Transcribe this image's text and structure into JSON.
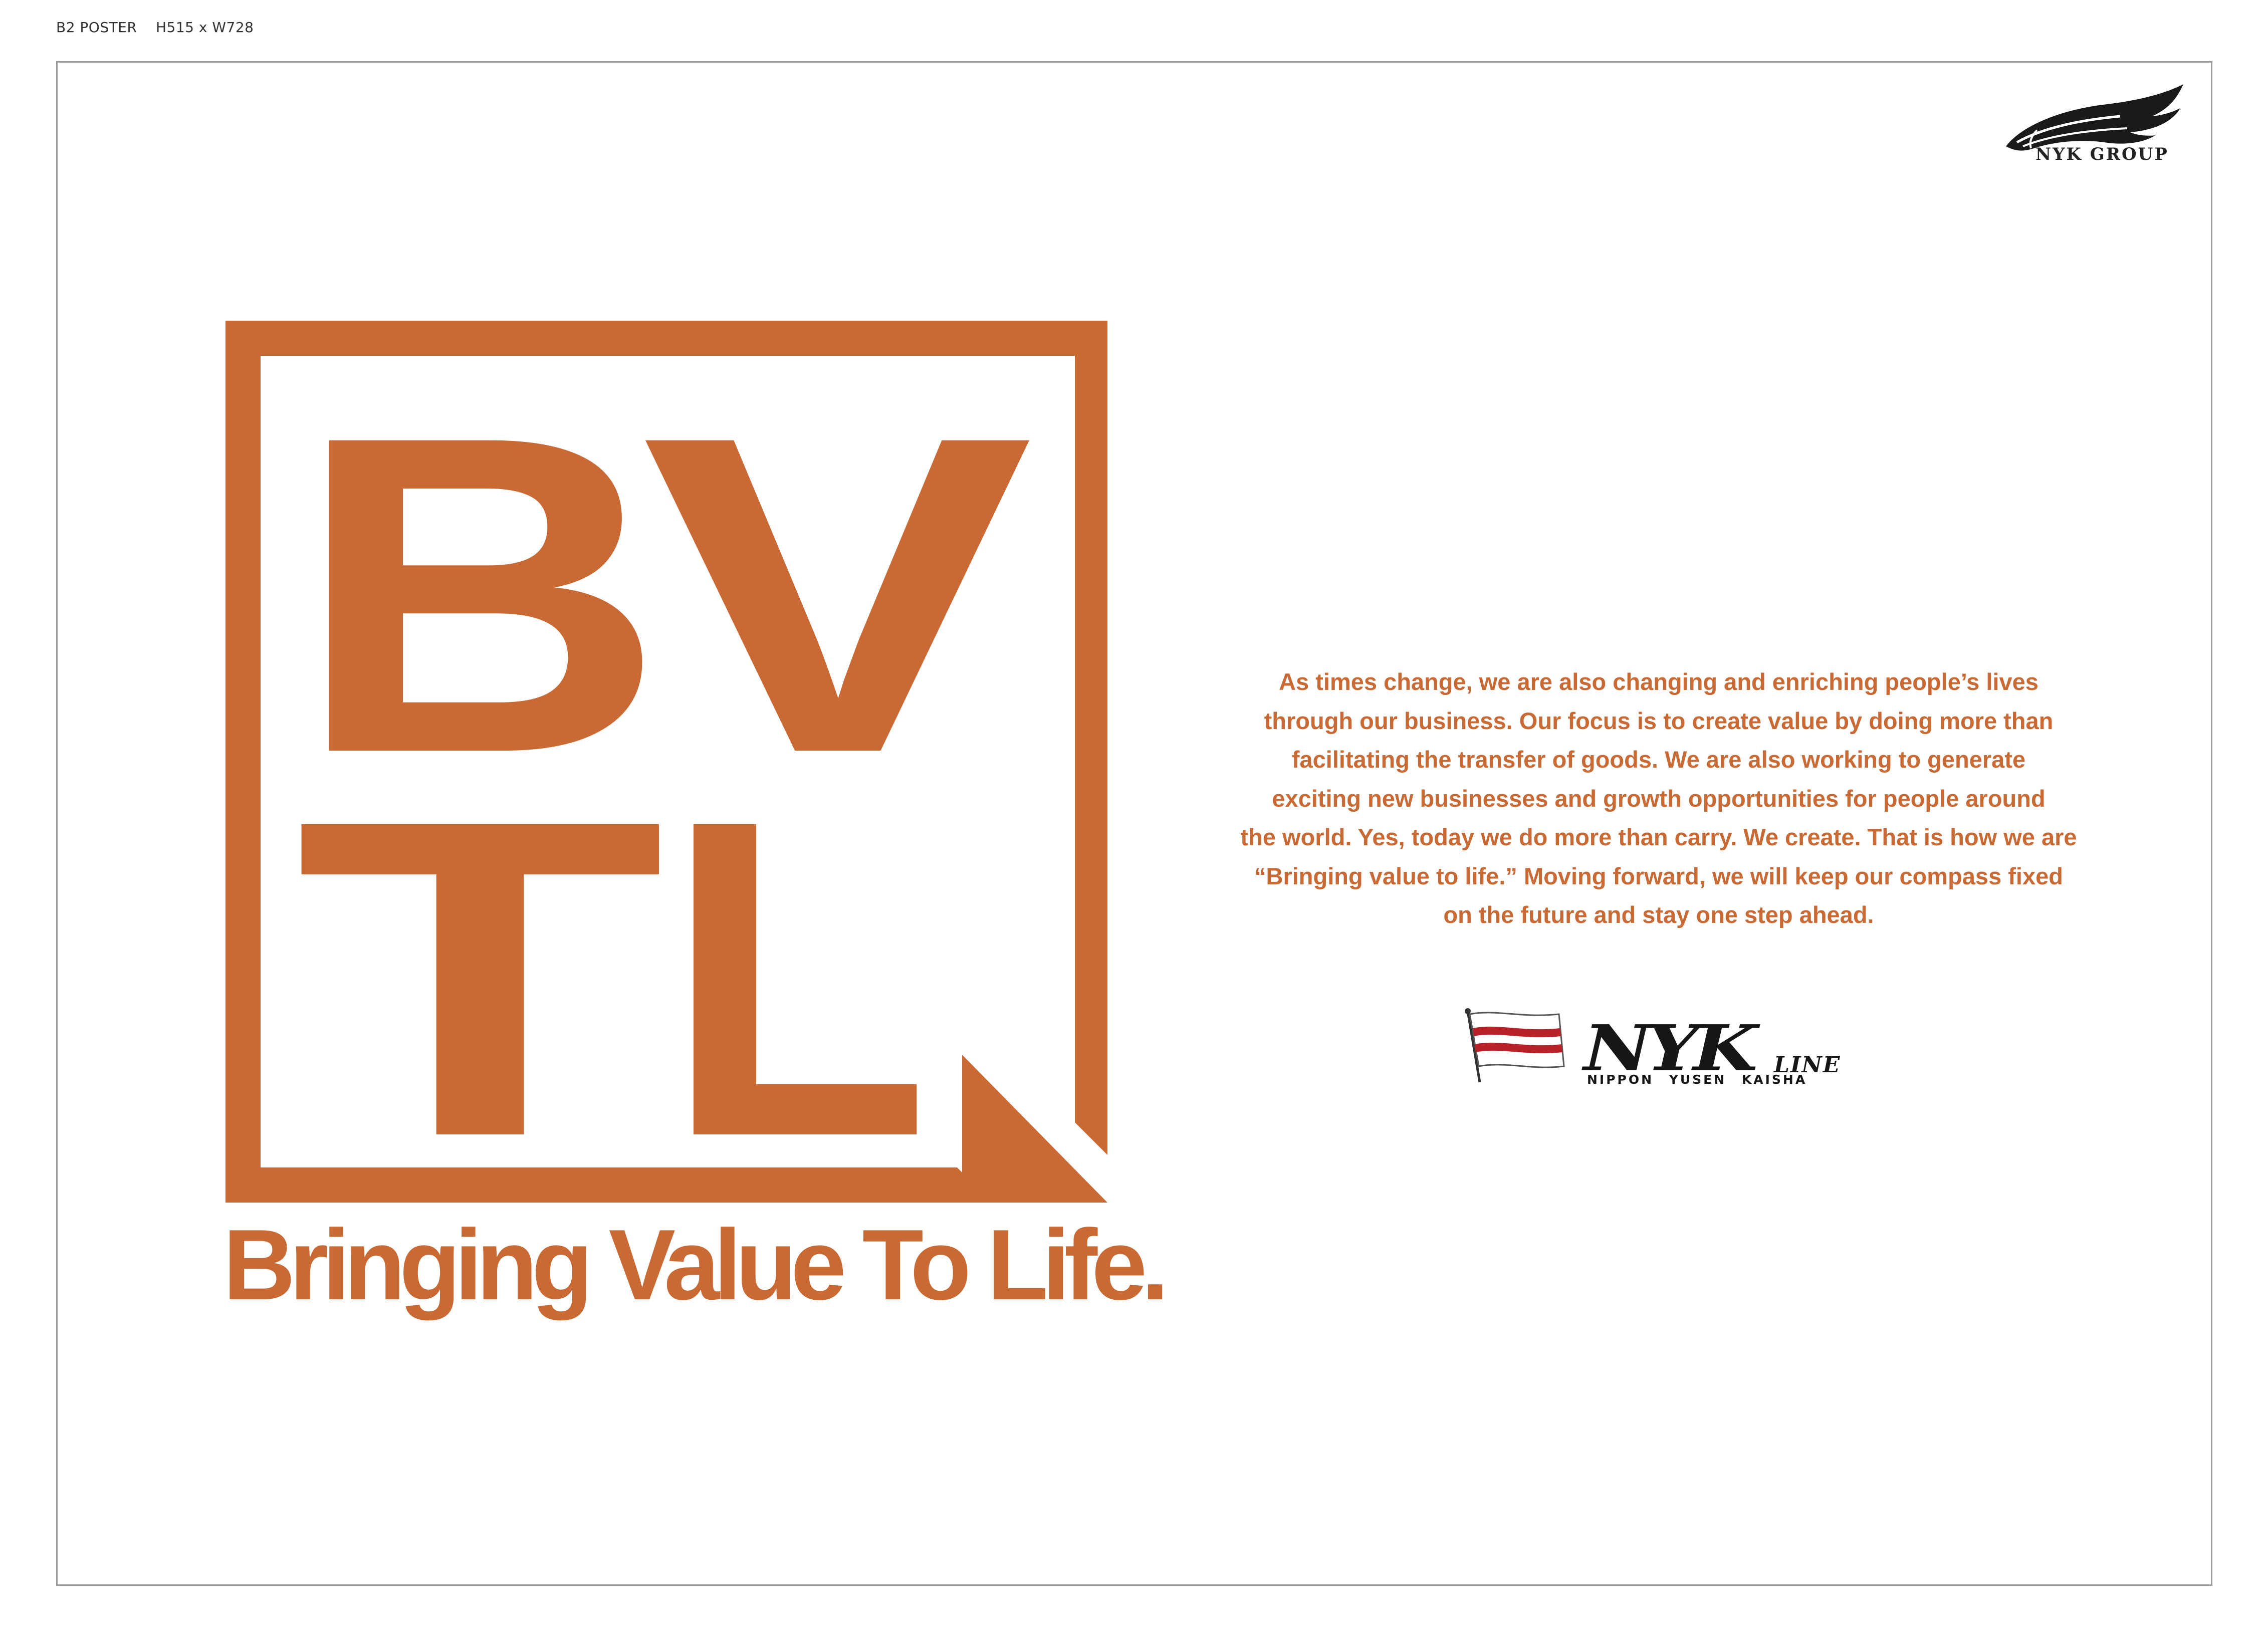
{
  "print_spec": "B2 POSTER    H515 x W728",
  "group_logo": {
    "icon": "wing-icon",
    "text": "NYK GROUP"
  },
  "mark": {
    "letters": [
      "B",
      "V",
      "T",
      "L"
    ],
    "color": "#c96934"
  },
  "tagline": "Bringing Value To Life.",
  "body_copy": [
    "As times change, we are also changing and enriching people’s lives",
    "through our business. Our focus is to create value by doing more than",
    "facilitating the transfer of goods. We are also working to generate",
    "exciting new businesses and growth opportunities for people around",
    "the world. Yes, today we do more than carry. We create. That is how we are",
    "“Bringing value to life.” Moving forward, we will keep our compass fixed",
    "on the future and stay one step ahead."
  ],
  "nyk_line_logo": {
    "flag_icon": "flag-icon",
    "wordmark": "NYK",
    "suffix": "LINE",
    "subtitle": "NIPPON YUSEN KAISHA",
    "flag_colors": [
      "#ffffff",
      "#b8232a"
    ]
  }
}
